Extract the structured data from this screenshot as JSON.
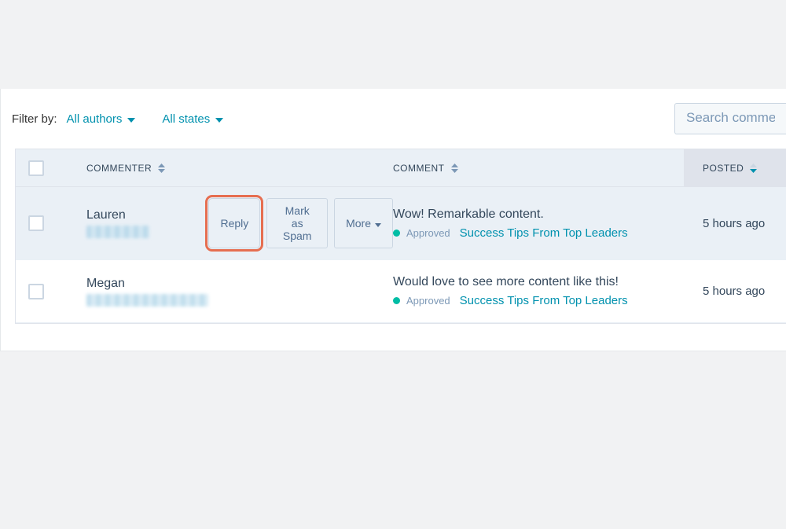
{
  "filters": {
    "label": "Filter by:",
    "authors": "All authors",
    "states": "All states"
  },
  "search": {
    "placeholder": "Search comments"
  },
  "columns": {
    "commenter": "COMMENTER",
    "comment": "COMMENT",
    "posted": "POSTED"
  },
  "actions": {
    "reply": "Reply",
    "spam": "Mark as Spam",
    "more": "More"
  },
  "status_label": "Approved",
  "rows": [
    {
      "name": "Lauren",
      "text": "Wow! Remarkable content.",
      "article": "Success Tips From Top Leaders",
      "posted": "5 hours ago",
      "selected": true,
      "blur": "short"
    },
    {
      "name": "Megan",
      "text": "Would love to see more content like this!",
      "article": "Success Tips From Top Leaders",
      "posted": "5 hours ago",
      "selected": false,
      "blur": "long"
    }
  ]
}
